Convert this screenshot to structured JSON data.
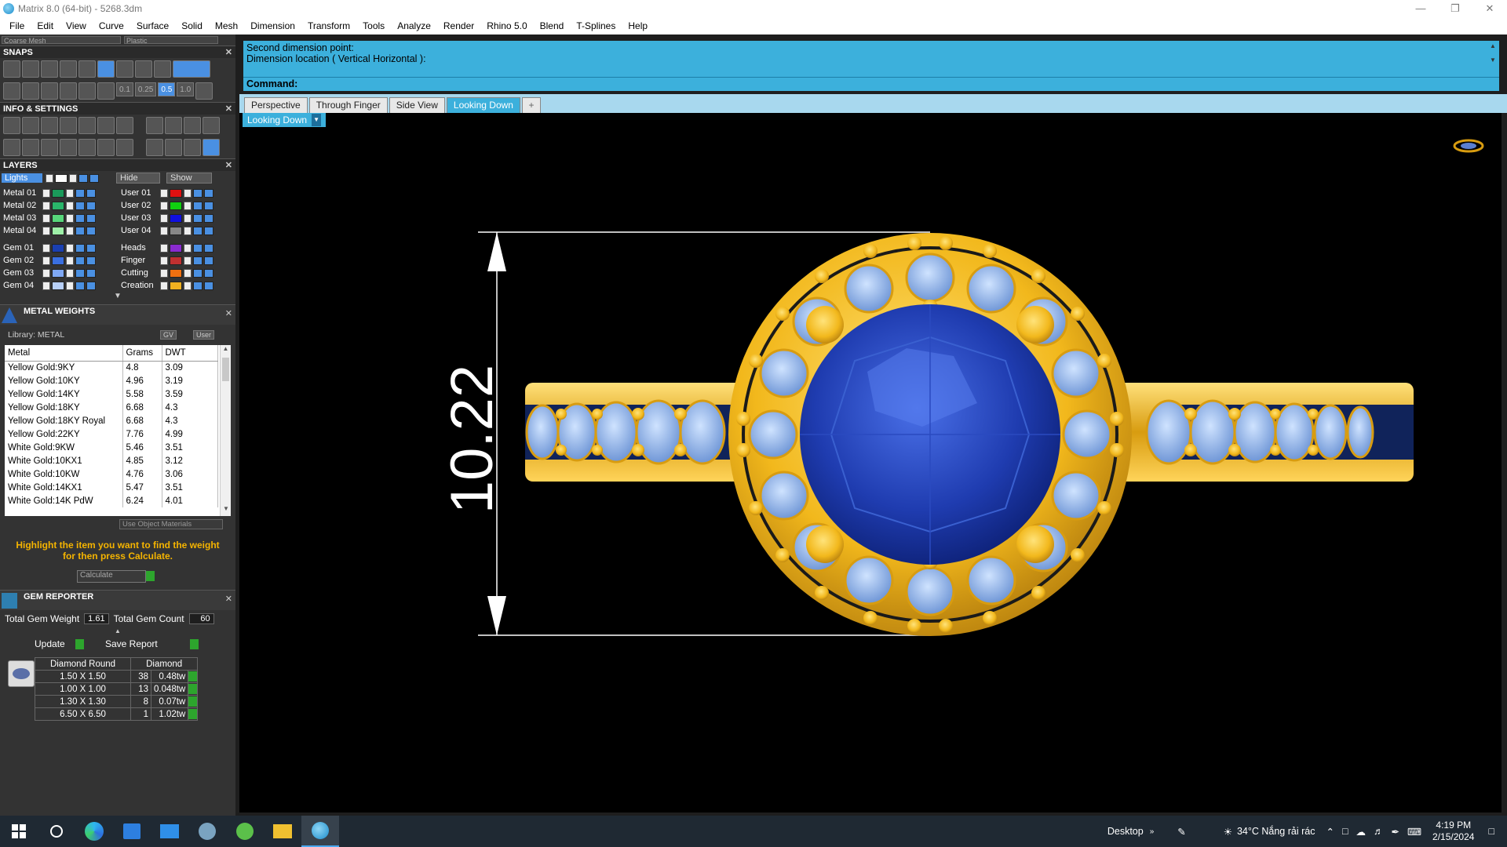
{
  "window": {
    "title": "Matrix 8.0 (64-bit) - 5268.3dm"
  },
  "menu": [
    "File",
    "Edit",
    "View",
    "Curve",
    "Surface",
    "Solid",
    "Mesh",
    "Dimension",
    "Transform",
    "Tools",
    "Analyze",
    "Render",
    "Rhino 5.0",
    "Blend",
    "T-Splines",
    "Help"
  ],
  "toolbar_top": {
    "mesh_select": "Coarse Mesh",
    "material_select": "Plastic"
  },
  "snaps": {
    "title": "SNAPS",
    "steps": [
      "0.1",
      "0.25",
      "0.5",
      "1.0"
    ]
  },
  "info_settings": {
    "title": "INFO & SETTINGS"
  },
  "layers": {
    "title": "LAYERS",
    "lights_label": "Lights",
    "hide_label": "Hide",
    "show_label": "Show",
    "left": [
      {
        "name": "Metal 01",
        "color": "#1a9a5a"
      },
      {
        "name": "Metal 02",
        "color": "#2ab56a"
      },
      {
        "name": "Metal 03",
        "color": "#57d67a"
      },
      {
        "name": "Metal 04",
        "color": "#9ef0a8"
      },
      {
        "name": "Gem 01",
        "color": "#1a3fb0"
      },
      {
        "name": "Gem 02",
        "color": "#3a6fe0"
      },
      {
        "name": "Gem 03",
        "color": "#7fa8f5"
      },
      {
        "name": "Gem 04",
        "color": "#b7cff8"
      }
    ],
    "right": [
      {
        "name": "User 01",
        "color": "#e01010"
      },
      {
        "name": "User 02",
        "color": "#10d010"
      },
      {
        "name": "User 03",
        "color": "#1010e0"
      },
      {
        "name": "User 04",
        "color": "#888888"
      },
      {
        "name": "Heads",
        "color": "#8a2bd0"
      },
      {
        "name": "Finger",
        "color": "#c03030"
      },
      {
        "name": "Cutting",
        "color": "#f07010"
      },
      {
        "name": "Creation",
        "color": "#f0b020"
      }
    ]
  },
  "metal_weights": {
    "title": "METAL WEIGHTS",
    "library": "Library: METAL",
    "gv_label": "GV",
    "user_label": "User",
    "columns": [
      "Metal",
      "Grams",
      "DWT"
    ],
    "rows": [
      [
        "Yellow Gold:9KY",
        "4.8",
        "3.09"
      ],
      [
        "Yellow Gold:10KY",
        "4.96",
        "3.19"
      ],
      [
        "Yellow Gold:14KY",
        "5.58",
        "3.59"
      ],
      [
        "Yellow Gold:18KY",
        "6.68",
        "4.3"
      ],
      [
        "Yellow Gold:18KY Royal",
        "6.68",
        "4.3"
      ],
      [
        "Yellow Gold:22KY",
        "7.76",
        "4.99"
      ],
      [
        "White Gold:9KW",
        "5.46",
        "3.51"
      ],
      [
        "White Gold:10KX1",
        "4.85",
        "3.12"
      ],
      [
        "White Gold:10KW",
        "4.76",
        "3.06"
      ],
      [
        "White Gold:14KX1",
        "5.47",
        "3.51"
      ],
      [
        "White Gold:14K PdW",
        "6.24",
        "4.01"
      ]
    ],
    "use_object_materials": "Use Object Materials",
    "hint": "Highlight the item you want to find the weight for then press Calculate.",
    "calculate": "Calculate"
  },
  "gem_reporter": {
    "title": "GEM REPORTER",
    "total_weight_label": "Total Gem Weight",
    "total_weight": "1.61",
    "total_count_label": "Total Gem Count",
    "total_count": "60",
    "update": "Update",
    "save_report": "Save Report",
    "shape": "Diamond Round",
    "material": "Diamond",
    "rows": [
      [
        "1.50 X 1.50",
        "38",
        "0.48tw"
      ],
      [
        "1.00 X 1.00",
        "13",
        "0.048tw"
      ],
      [
        "1.30 X 1.30",
        "8",
        "0.07tw"
      ],
      [
        "6.50 X 6.50",
        "1",
        "1.02tw"
      ]
    ]
  },
  "command": {
    "line1": "Second dimension point:",
    "line2": "Dimension location ( Vertical  Horizontal ):",
    "prompt": "Command:"
  },
  "tabs": [
    "Perspective",
    "Through Finger",
    "Side View",
    "Looking Down",
    "+"
  ],
  "viewport": {
    "label": "Looking Down",
    "dimension": "10.22"
  },
  "taskbar": {
    "desktop": "Desktop",
    "weather": "34°C  Nắng rải rác",
    "time": "4:19 PM",
    "date": "2/15/2024"
  }
}
